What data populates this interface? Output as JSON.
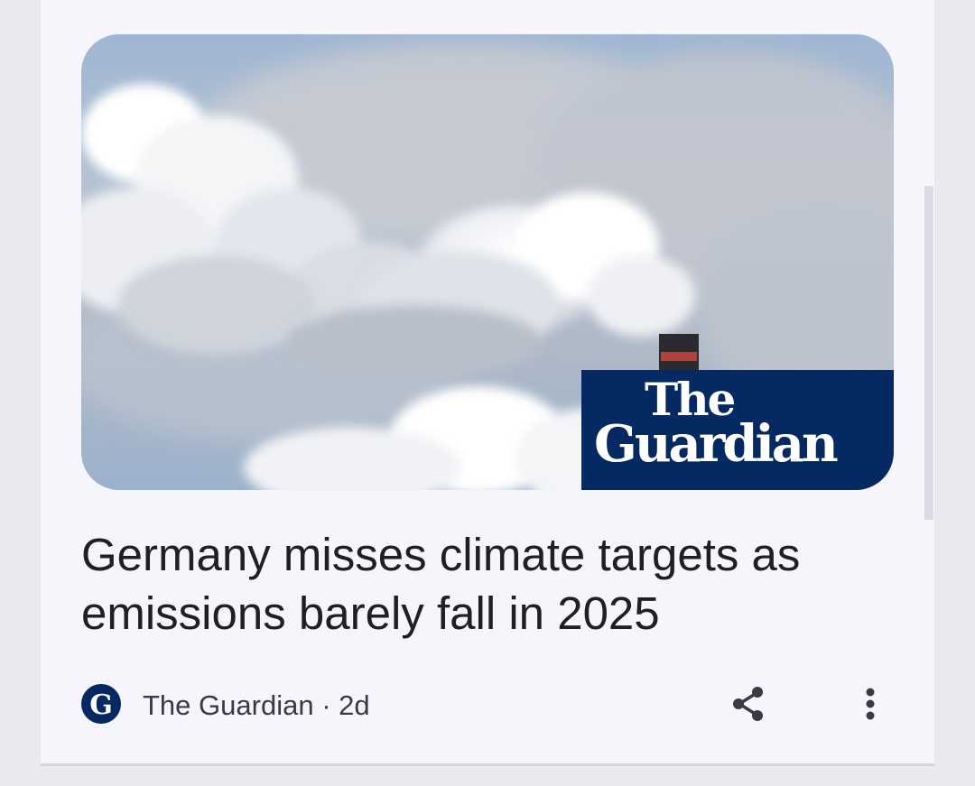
{
  "article": {
    "headline": "Germany misses climate targets as emissions barely fall in 2025",
    "image_alt": "White clouds of steam rising from a chimney against a blue sky",
    "image_brand_line1": "The",
    "image_brand_line2": "Guardian",
    "source_name": "The Guardian",
    "separator": "·",
    "age": "2d"
  },
  "icons": {
    "source_logo": "guardian-g-logo-icon",
    "share": "share-icon",
    "more": "more-vert-icon"
  },
  "colors": {
    "brand_navy": "#052962",
    "card_bg": "#f6f5fc",
    "page_bg": "#e9e9f0",
    "headline_text": "#1f1f24",
    "meta_text": "#3a3a42"
  }
}
